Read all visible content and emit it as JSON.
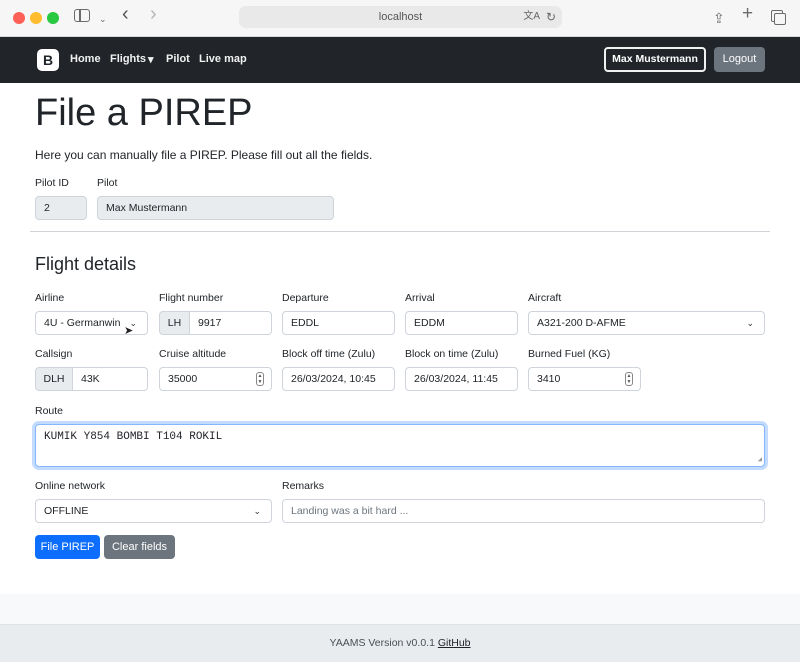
{
  "browser": {
    "url": "localhost",
    "icons": [
      "sidebar-icon",
      "back-icon",
      "forward-icon",
      "translate-icon",
      "reload-icon",
      "share-icon",
      "new-tab-icon",
      "tabs-overview-icon"
    ]
  },
  "navbar": {
    "brand": "B",
    "links": [
      "Home",
      "Flights",
      "Pilot",
      "Live map"
    ],
    "flights_caret": "▾",
    "user_button": "Max Mustermann",
    "logout": "Logout"
  },
  "page": {
    "title": "File a PIREP",
    "lead": "Here you can manually file a PIREP. Please fill out all the fields.",
    "pilot_id_label": "Pilot ID",
    "pilot_id_value": "2",
    "pilot_label": "Pilot",
    "pilot_value": "Max Mustermann",
    "section_title": "Flight details"
  },
  "form": {
    "airline_label": "Airline",
    "airline_value": "4U - Germanwin",
    "flight_number_label": "Flight number",
    "flight_number_prefix": "LH",
    "flight_number_value": "9917",
    "departure_label": "Departure",
    "departure_value": "EDDL",
    "arrival_label": "Arrival",
    "arrival_value": "EDDM",
    "aircraft_label": "Aircraft",
    "aircraft_value": "A321-200 D-AFME",
    "callsign_label": "Callsign",
    "callsign_prefix": "DLH",
    "callsign_value": "43K",
    "cruise_label": "Cruise altitude",
    "cruise_value": "35000",
    "block_off_label": "Block off time (Zulu)",
    "block_off_value": "26/03/2024, 10:45",
    "block_on_label": "Block on time (Zulu)",
    "block_on_value": "26/03/2024, 11:45",
    "fuel_label": "Burned Fuel (KG)",
    "fuel_value": "3410",
    "route_label": "Route",
    "route_value": "KUMIK Y854 BOMBI T104 ROKIL",
    "network_label": "Online network",
    "network_value": "OFFLINE",
    "remarks_label": "Remarks",
    "remarks_placeholder": "Landing was a bit hard ...",
    "submit": "File PIREP",
    "clear": "Clear fields"
  },
  "footer": {
    "text": "YAAMS Version v0.0.1",
    "link": "GitHub"
  }
}
